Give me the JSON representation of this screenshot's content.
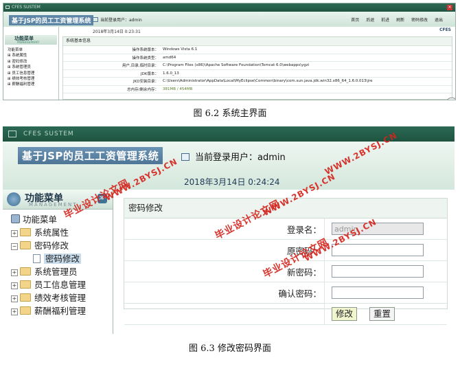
{
  "fig1": {
    "window_title": "CFES SUSTEM",
    "system_name": "基于JSP的员工工资管理系统",
    "current_user_label": "当前登录用户：admin",
    "nav": [
      "首页",
      "后退",
      "前进",
      "刷新",
      "密码修改",
      "退出"
    ],
    "datetime": "2018年3月14日   0:23:31",
    "logo_text": "CFES",
    "menu_title": "功能菜单",
    "menu_subtitle": "MANAGEMENT",
    "tree": [
      "功能菜单",
      "系统属性",
      "密码修改",
      "系统管理员",
      "员工信息管理",
      "绩效考核管理",
      "薪酬福利管理"
    ],
    "panel_title": "系统基本信息",
    "info_rows": [
      {
        "label": "操作系统版本：",
        "value": "Windows Vista  6.1"
      },
      {
        "label": "操作系统类型：",
        "value": "amd64"
      },
      {
        "label": "用户,目录,临时目录：",
        "value": "C:\\Program Files (x86)\\Apache Software Foundation\\Tomcat 6.0\\webapps\\ygzi"
      },
      {
        "label": "JDK版本：",
        "value": "1.6.0_13"
      },
      {
        "label": "JKD安装目录：",
        "value": "C:\\Users\\Administrator\\AppData\\Local\\MyEclipse\\Common\\binary\\com.sun.java.jdk.win32.x86_64_1.6.0.013\\jre"
      },
      {
        "label": "总内存/剩余内存：",
        "value": "381MB / 454MB"
      }
    ]
  },
  "caption1": "图 6.2  系统主界面",
  "fig2": {
    "window_title": "CFES SUSTEM",
    "system_name": "基于JSP的员工工资管理系统",
    "current_user_label": "当前登录用户：admin",
    "datetime": "2018年3月14日   0:24:24",
    "menu_title": "功能菜单",
    "menu_subtitle": "MANAGEMENT",
    "menu_toggle": "≫",
    "tree_root": "功能菜单",
    "tree": {
      "system_props": "系统属性",
      "password_group": "密码修改",
      "password_leaf": "密码修改",
      "sys_admin": "系统管理员",
      "employee_info": "员工信息管理",
      "performance": "绩效考核管理",
      "salary": "薪酬福利管理"
    },
    "panel_title": "密码修改",
    "form": {
      "login_label": "登录名：",
      "login_value": "admin",
      "old_pwd_label": "原密码：",
      "new_pwd_label": "新密码：",
      "confirm_pwd_label": "确认密码：",
      "submit": "修改",
      "reset": "重置"
    }
  },
  "caption2": "图 6.3  修改密码界面",
  "watermarks": [
    "毕业设计论文网",
    "WWW.2BYSJ.CN"
  ]
}
